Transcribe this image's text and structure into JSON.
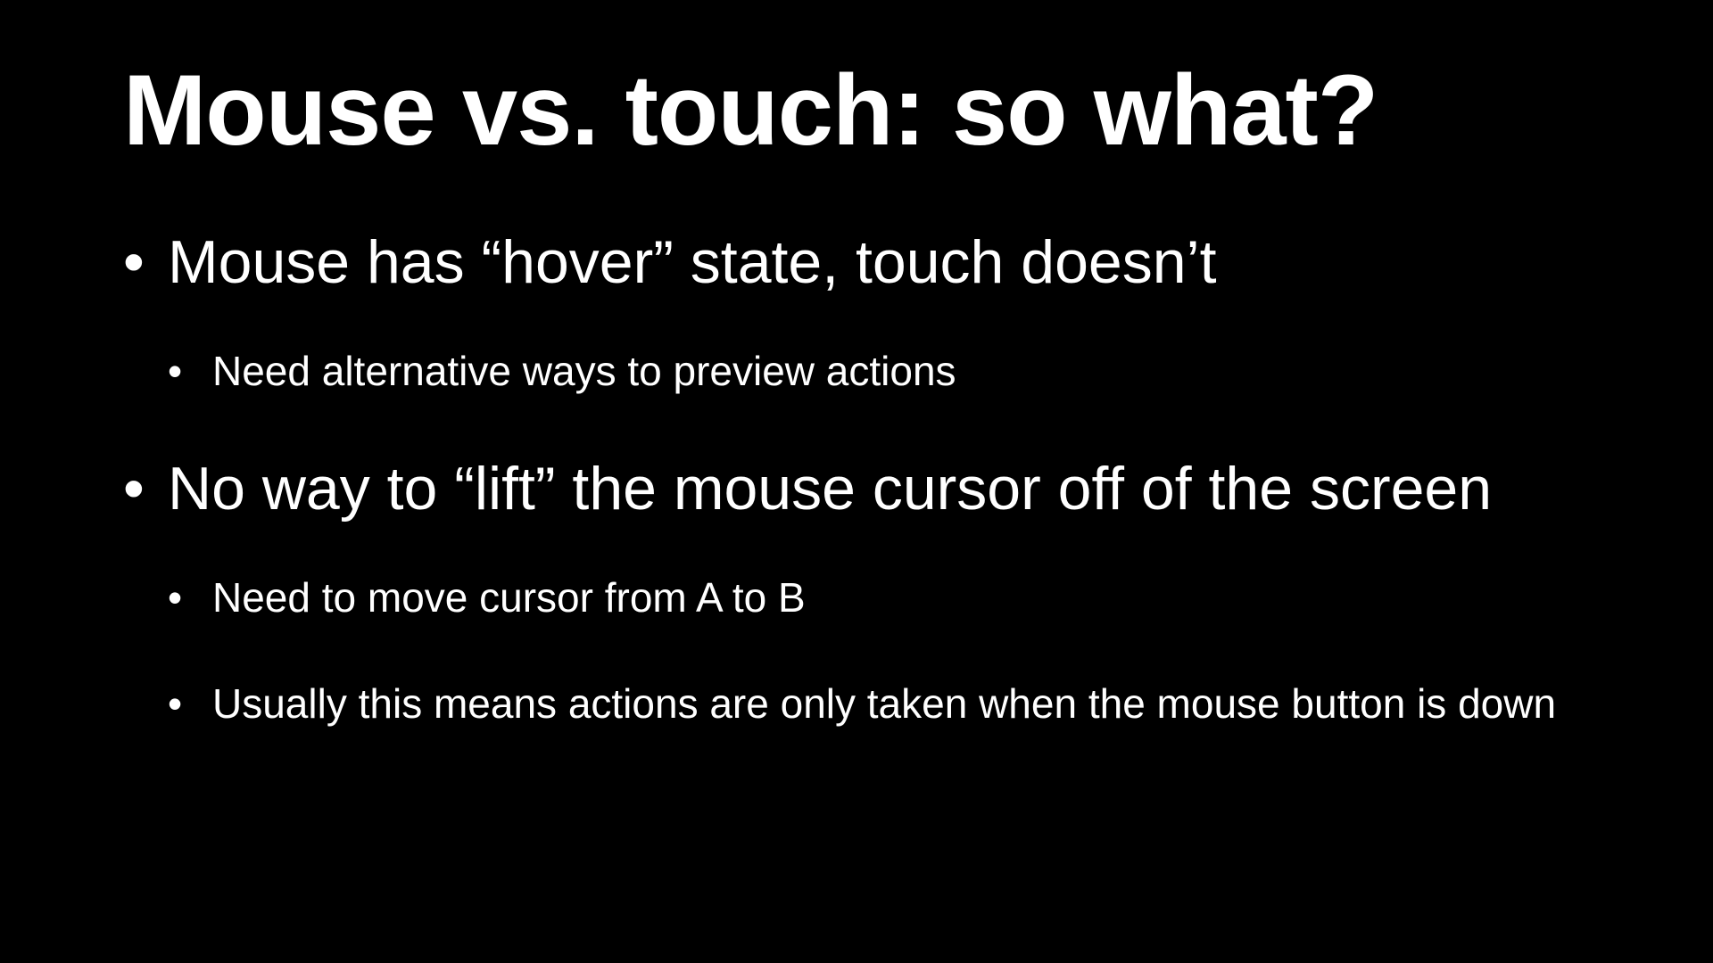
{
  "slide": {
    "title": "Mouse vs. touch: so what?",
    "bullet_glyph": "•",
    "bullets": [
      {
        "text": "Mouse has “hover” state, touch doesn’t",
        "sub": [
          "Need alternative ways to preview actions"
        ]
      },
      {
        "text": "No way to “lift” the mouse cursor off of the screen",
        "sub": [
          "Need to move cursor from A to B",
          "Usually this means actions are only taken when the mouse button is down"
        ]
      }
    ]
  },
  "colors": {
    "background": "#000000",
    "text": "#ffffff"
  }
}
